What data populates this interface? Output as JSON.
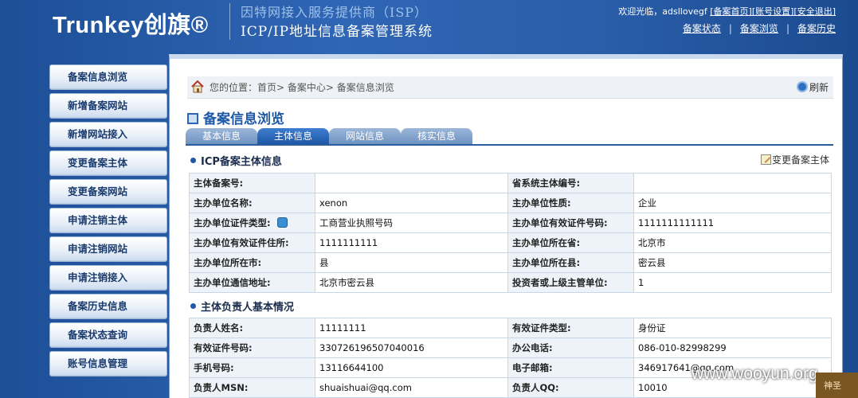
{
  "header": {
    "logo_text": "Trunkey创旗®",
    "subtitle_1": "因特网接入服务提供商（ISP）",
    "subtitle_2": "ICP/IP地址信息备案管理系统",
    "welcome_text": "欢迎光临，adsllovegf",
    "links": [
      {
        "label": "[备案首页]"
      },
      {
        "label": "[账号设置]"
      },
      {
        "label": "[安全退出]"
      }
    ],
    "nav_links": [
      {
        "label": "备案状态"
      },
      {
        "label": "备案浏览"
      },
      {
        "label": "备案历史"
      }
    ],
    "nav_separator": "|"
  },
  "sidebar": {
    "items": [
      {
        "label": "备案信息浏览"
      },
      {
        "label": "新增备案网站"
      },
      {
        "label": "新增网站接入"
      },
      {
        "label": "变更备案主体"
      },
      {
        "label": "变更备案网站"
      },
      {
        "label": "申请注销主体"
      },
      {
        "label": "申请注销网站"
      },
      {
        "label": "申请注销接入"
      },
      {
        "label": "备案历史信息"
      },
      {
        "label": "备案状态查询"
      },
      {
        "label": "账号信息管理"
      }
    ]
  },
  "breadcrumb": {
    "text": "您的位置：首页> 备案中心> 备案信息浏览",
    "refresh_label": "刷新"
  },
  "main": {
    "title": "备案信息浏览",
    "tabs": [
      {
        "label": "基本信息",
        "active": false
      },
      {
        "label": "主体信息",
        "active": true
      },
      {
        "label": "网站信息",
        "active": false
      },
      {
        "label": "核实信息",
        "active": false
      }
    ],
    "section1_title": "ICP备案主体信息",
    "change_label": "变更备案主体",
    "section1_rows": [
      [
        "主体备案号:",
        "",
        "省系统主体编号:",
        ""
      ],
      [
        "主办单位名称:",
        "xenon",
        "主办单位性质:",
        "企业"
      ],
      [
        "主办单位证件类型:",
        "工商营业执照号码",
        "主办单位有效证件号码:",
        "1111111111111"
      ],
      [
        "主办单位有效证件住所:",
        "1111111111",
        "主办单位所在省:",
        "北京市"
      ],
      [
        "主办单位所在市:",
        "县",
        "主办单位所在县:",
        "密云县"
      ],
      [
        "主办单位通信地址:",
        "北京市密云县",
        "投资者或上级主管单位:",
        "1"
      ]
    ],
    "section2_title": "主体负责人基本情况",
    "section2_rows": [
      [
        "负责人姓名:",
        "11111111",
        "有效证件类型:",
        "身份证"
      ],
      [
        "有效证件号码:",
        "330726196507040016",
        "办公电话:",
        "086-010-82998299"
      ],
      [
        "手机号码:",
        "13116644100",
        "电子邮箱:",
        "346917641@qq.com"
      ],
      [
        "负责人MSN:",
        "shuaishuai@qq.com",
        "负责人QQ:",
        "10010"
      ]
    ]
  },
  "watermark": "www.wooyun.org",
  "corner_text": "神圣",
  "colors": {
    "background": "#2a5ea9",
    "accent": "#1f58a6",
    "label_bg": "#eef3f9"
  }
}
